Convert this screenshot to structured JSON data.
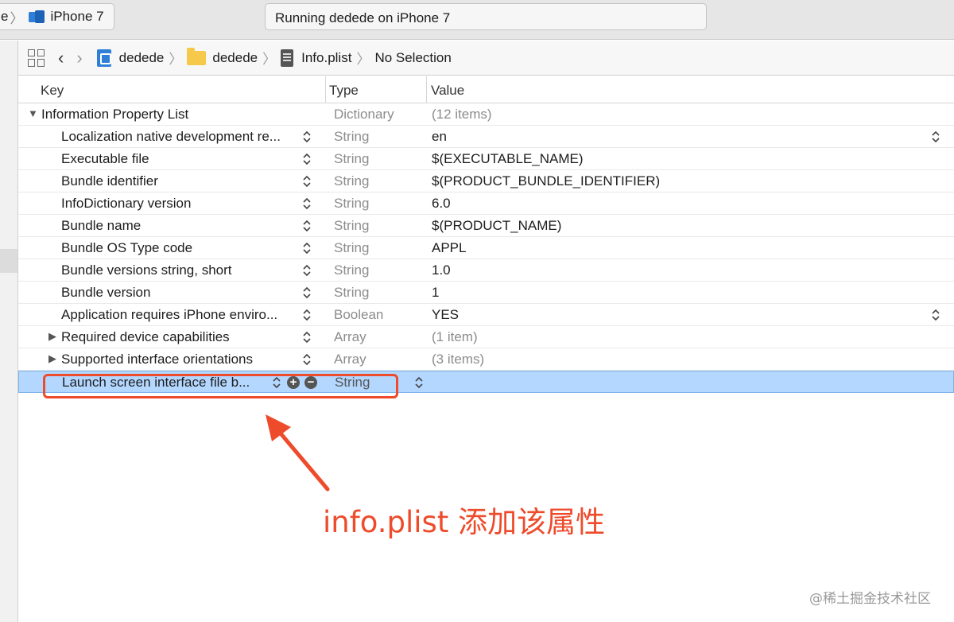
{
  "titlebar": {
    "scheme_prefix": "e",
    "device": "iPhone 7",
    "activity": "Running dedede on iPhone 7"
  },
  "jumpbar": {
    "crumbs": [
      "dedede",
      "dedede",
      "Info.plist",
      "No Selection"
    ]
  },
  "table": {
    "headers": {
      "key": "Key",
      "type": "Type",
      "value": "Value"
    },
    "root": {
      "key": "Information Property List",
      "type": "Dictionary",
      "value": "(12 items)"
    },
    "rows": [
      {
        "key": "Localization native development re...",
        "type": "String",
        "value": "en"
      },
      {
        "key": "Executable file",
        "type": "String",
        "value": "$(EXECUTABLE_NAME)"
      },
      {
        "key": "Bundle identifier",
        "type": "String",
        "value": "$(PRODUCT_BUNDLE_IDENTIFIER)"
      },
      {
        "key": "InfoDictionary version",
        "type": "String",
        "value": "6.0"
      },
      {
        "key": "Bundle name",
        "type": "String",
        "value": "$(PRODUCT_NAME)"
      },
      {
        "key": "Bundle OS Type code",
        "type": "String",
        "value": "APPL"
      },
      {
        "key": "Bundle versions string, short",
        "type": "String",
        "value": "1.0"
      },
      {
        "key": "Bundle version",
        "type": "String",
        "value": "1"
      },
      {
        "key": "Application requires iPhone enviro...",
        "type": "Boolean",
        "value": "YES"
      },
      {
        "key": "Required device capabilities",
        "type": "Array",
        "value": "(1 item)"
      },
      {
        "key": "Supported interface orientations",
        "type": "Array",
        "value": "(3 items)"
      }
    ],
    "selected": {
      "key": "Launch screen interface file b...",
      "type": "String",
      "value": ""
    }
  },
  "annotation": {
    "text": "info.plist 添加该属性",
    "color": "#ee4b2b"
  },
  "watermark": "@稀土掘金技术社区"
}
